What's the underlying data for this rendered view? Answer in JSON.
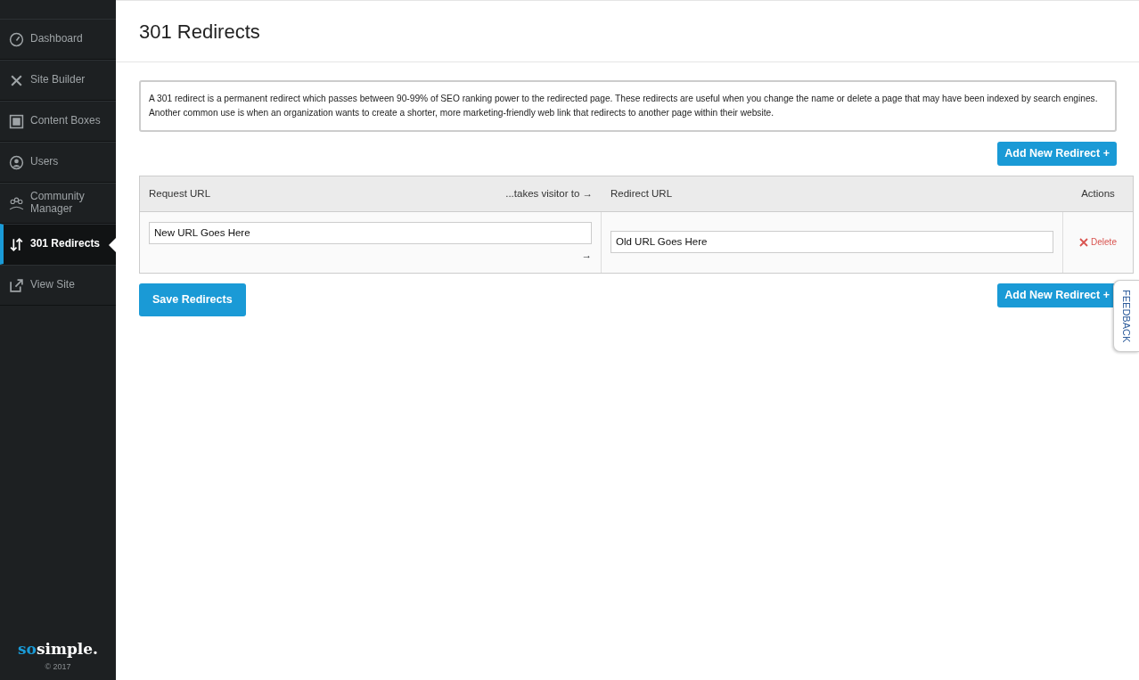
{
  "sidebar": {
    "items": [
      {
        "label": "Dashboard",
        "selected": false
      },
      {
        "label": "Site Builder",
        "selected": false
      },
      {
        "label": "Content Boxes",
        "selected": false
      },
      {
        "label": "Users",
        "selected": false
      },
      {
        "label": "Community Manager",
        "selected": false
      },
      {
        "label": "301 Redirects",
        "selected": true
      },
      {
        "label": "View Site",
        "selected": false
      }
    ],
    "logo": {
      "accent": "so",
      "rest": "simple."
    },
    "copyright": "© 2017"
  },
  "page_title": "301 Redirects",
  "description": "A 301 redirect is a permanent redirect which passes between 90-99% of SEO ranking power to the redirected page. These redirects are useful when you change the name or delete a page that may have been indexed by search engines. Another common use is when an organization wants to create a shorter, more marketing-friendly web link that redirects to another page within their website.",
  "add_button_top": "Add New Redirect +",
  "table": {
    "columns": {
      "request": "Request URL",
      "takes": "...takes visitor to →",
      "redirect": "Redirect URL",
      "actions": "Actions"
    },
    "rows": [
      {
        "request": "New URL Goes Here",
        "arrow": "→",
        "redirect": "Old URL Goes Here",
        "delete": "Delete"
      }
    ]
  },
  "save_button": "Save Redirects",
  "add_button_bottom": "Add New Redirect +",
  "feedback": "FEEDBACK"
}
